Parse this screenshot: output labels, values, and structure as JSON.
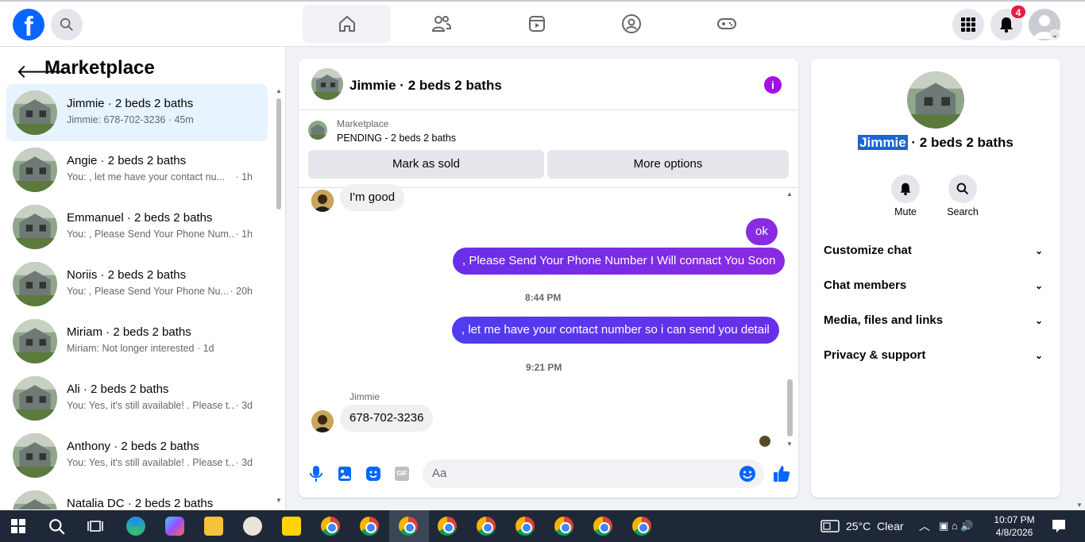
{
  "topnav": {
    "logo": "f",
    "tabs": [
      "home",
      "friends",
      "watch",
      "groups",
      "gaming"
    ],
    "notifications_count": "4"
  },
  "left": {
    "title": "Marketplace",
    "conversations": [
      {
        "title": "Jimmie · 2 beds 2 baths",
        "preview": "Jimmie: 678-702-3236 · 45m",
        "time": ""
      },
      {
        "title": "Angie · 2 beds 2 baths",
        "preview": "You: , let me have your contact nu...",
        "time": "· 1h"
      },
      {
        "title": "Emmanuel · 2 beds 2 baths",
        "preview": "You: , Please Send Your Phone Num...",
        "time": "· 1h"
      },
      {
        "title": "Noriis · 2 beds 2 baths",
        "preview": "You: , Please Send Your Phone Nu...",
        "time": "· 20h"
      },
      {
        "title": "Miriam · 2 beds 2 baths",
        "preview": "Miriam: Not longer interested · 1d",
        "time": ""
      },
      {
        "title": "Ali · 2 beds 2 baths",
        "preview": "You: Yes, it's still available! . Please t...",
        "time": "· 3d"
      },
      {
        "title": "Anthony · 2 beds 2 baths",
        "preview": "You: Yes, it's still available! . Please t...",
        "time": "· 3d"
      },
      {
        "title": "Natalia DC · 2 beds 2 baths",
        "preview": "",
        "time": ""
      }
    ]
  },
  "chat": {
    "header_title": "Jimmie · 2 beds 2 baths",
    "marketplace_label": "Marketplace",
    "listing_status": "PENDING - 2 beds 2 baths",
    "mark_sold": "Mark as sold",
    "more_options": "More options",
    "messages": {
      "m1": "I'm good",
      "m2": "ok",
      "m3": ", Please Send Your Phone Number I Will connact You Soon",
      "ts1": "8:44 PM",
      "m4": ", let me have your contact number so i can send you detail",
      "ts2": "9:21 PM",
      "sender": "Jimmie",
      "m5": "678-702-3236"
    },
    "composer_placeholder": "Aa"
  },
  "info": {
    "name_highlight": "Jimmie",
    "name_rest": " · 2 beds 2 baths",
    "mute_label": "Mute",
    "search_label": "Search",
    "sections": [
      "Customize chat",
      "Chat members",
      "Media, files and links",
      "Privacy & support"
    ]
  },
  "taskbar": {
    "weather": "25°C  Clear",
    "time": "10:07 PM",
    "date": "4/8/2026"
  },
  "colors": {
    "accent": "#0866ff",
    "bubble_out": "#7b2ff0",
    "highlight": "#1a66d2"
  }
}
